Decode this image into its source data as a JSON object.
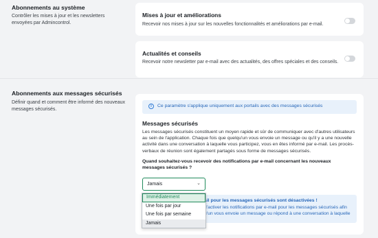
{
  "system": {
    "title": "Abonnements au système",
    "description": "Contrôler les mises à jour et les newsletters envoyées par Admincontrol.",
    "cards": [
      {
        "title": "Mises à jour et améliorations",
        "text": "Recevoir nos mises à jour sur les nouvelles fonctionnalités et améliorations par e-mail.",
        "enabled": false
      },
      {
        "title": "Actualités et conseils",
        "text": "Recevoir notre newsletter par e-mail avec des actualités, des offres spéciales et des conseils.",
        "enabled": false
      }
    ]
  },
  "secure": {
    "title": "Abonnements aux messages sécurisés",
    "description": "Définir quand et comment être informé des nouveaux messages sécurisés.",
    "info": "Ce paramètre s'applique uniquement aux portails avec des messages sécurisés",
    "messages_title": "Messages sécurisés",
    "messages_body": "Les messages sécurisés constituent un moyen rapide et sûr de communiquer avec d'autres utilisateurs au sein de l'application. Chaque fois que quelqu'un vous envoie un message ou qu'il y a une nouvelle activité dans une conversation à laquelle vous participez, vous en êtes informé par e-mail. Les procès-verbaux de réunion sont également partagés sous forme de messages sécurisés.",
    "question": "Quand souhaitez-vous recevoir des notifications par e-mail concernant les nouveaux messages sécurisés ?",
    "select_value": "Jamais",
    "warning_title": "ail pour les messages sécurisés sont désactivées !",
    "warning_text": "d'activer les notifications par e-mail pour les messages sécurisés afin u'un vous envoie un message ou répond à une conversation à laquelle",
    "options": [
      "Immédiatement",
      "Une fois par jour",
      "Une fois par semaine",
      "Jamais"
    ]
  }
}
